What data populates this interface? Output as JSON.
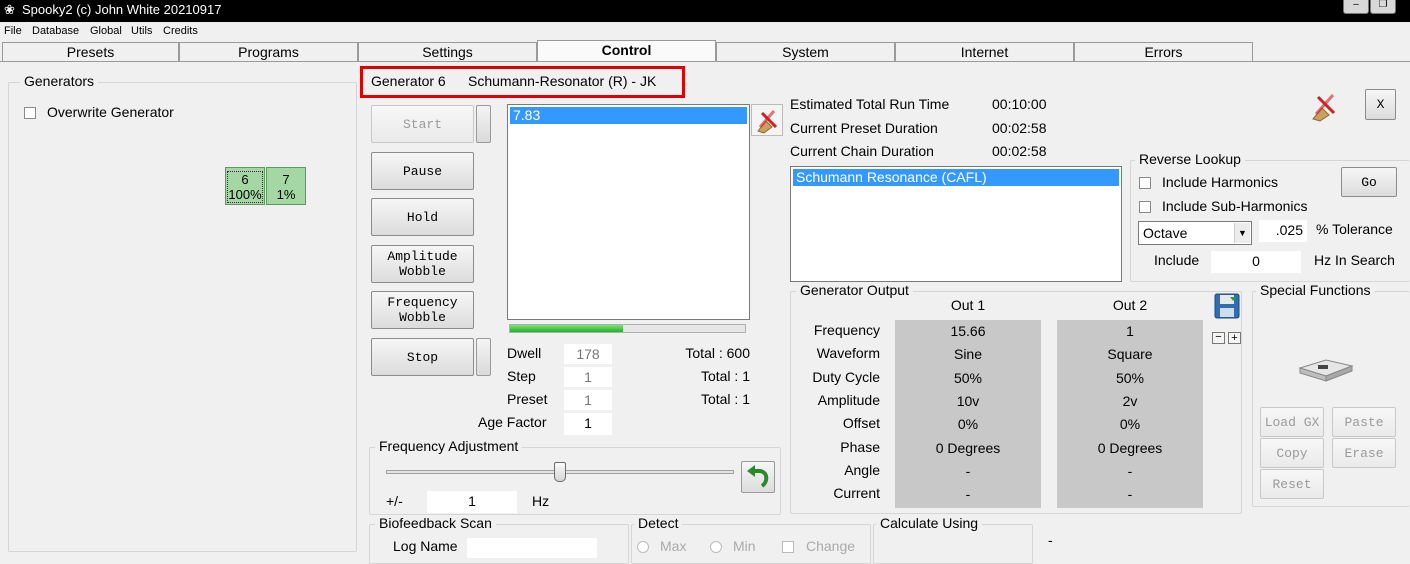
{
  "window": {
    "title": "Spooky2 (c) John White 20210917"
  },
  "menu": [
    "File",
    "Database",
    "Global",
    "Utils",
    "Credits"
  ],
  "tabs": [
    "Presets",
    "Programs",
    "Settings",
    "Control",
    "System",
    "Internet",
    "Errors"
  ],
  "active_tab": "Control",
  "generators": {
    "group_label": "Generators",
    "overwrite_label": "Overwrite Generator",
    "items": [
      {
        "num": "6",
        "pct": "100%"
      },
      {
        "num": "7",
        "pct": "1%"
      }
    ]
  },
  "header": {
    "gen_label": "Generator 6",
    "program": "Schumann-Resonator (R) - JK"
  },
  "buttons": {
    "start": "Start",
    "pause": "Pause",
    "hold": "Hold",
    "amp_wobble": "Amplitude\nWobble",
    "freq_wobble": "Frequency\nWobble",
    "stop": "Stop",
    "close": "X",
    "go": "Go",
    "load_gx": "Load GX",
    "paste": "Paste",
    "copy": "Copy",
    "erase": "Erase",
    "reset": "Reset"
  },
  "freq_list": [
    "7.83"
  ],
  "progress": 0.48,
  "stats": {
    "dwell_label": "Dwell",
    "dwell": "178",
    "dwell_total": "Total : 600",
    "step_label": "Step",
    "step": "1",
    "step_total": "Total : 1",
    "preset_label": "Preset",
    "preset": "1",
    "preset_total": "Total : 1",
    "age_label": "Age Factor",
    "age": "1"
  },
  "runtime": {
    "est_label": "Estimated Total Run Time",
    "est": "00:10:00",
    "preset_label": "Current Preset Duration",
    "preset": "00:02:58",
    "chain_label": "Current Chain Duration",
    "chain": "00:02:58"
  },
  "preset_list": [
    "Schumann Resonance (CAFL)"
  ],
  "reverse": {
    "label": "Reverse Lookup",
    "harmonics": "Include Harmonics",
    "sub": "Include Sub-Harmonics",
    "octave": "Octave",
    "tolerance": ".025",
    "tolerance_label": "% Tolerance",
    "include_label": "Include",
    "include_val": "0",
    "hz_label": "Hz In Search"
  },
  "output": {
    "label": "Generator Output",
    "out1": "Out 1",
    "out2": "Out 2",
    "rows": [
      {
        "name": "Frequency",
        "o1": "15.66",
        "o2": "1"
      },
      {
        "name": "Waveform",
        "o1": "Sine",
        "o2": "Square"
      },
      {
        "name": "Duty Cycle",
        "o1": "50%",
        "o2": "50%"
      },
      {
        "name": "Amplitude",
        "o1": "10v",
        "o2": "2v"
      },
      {
        "name": "Offset",
        "o1": "0%",
        "o2": "0%"
      },
      {
        "name": "Phase",
        "o1": "0 Degrees",
        "o2": "0 Degrees"
      },
      {
        "name": "Angle",
        "o1": "-",
        "o2": "-"
      },
      {
        "name": "Current",
        "o1": "-",
        "o2": "-"
      }
    ]
  },
  "special": {
    "label": "Special Functions"
  },
  "freq_adj": {
    "label": "Frequency Adjustment",
    "pm": "+/-",
    "value": "1",
    "unit": "Hz",
    "slider": 0.5
  },
  "bio": {
    "label": "Biofeedback Scan",
    "log_name": "Log Name"
  },
  "detect": {
    "label": "Detect",
    "max": "Max",
    "min": "Min",
    "change": "Change"
  },
  "calc": {
    "label": "Calculate Using"
  },
  "misc_dash": "-"
}
